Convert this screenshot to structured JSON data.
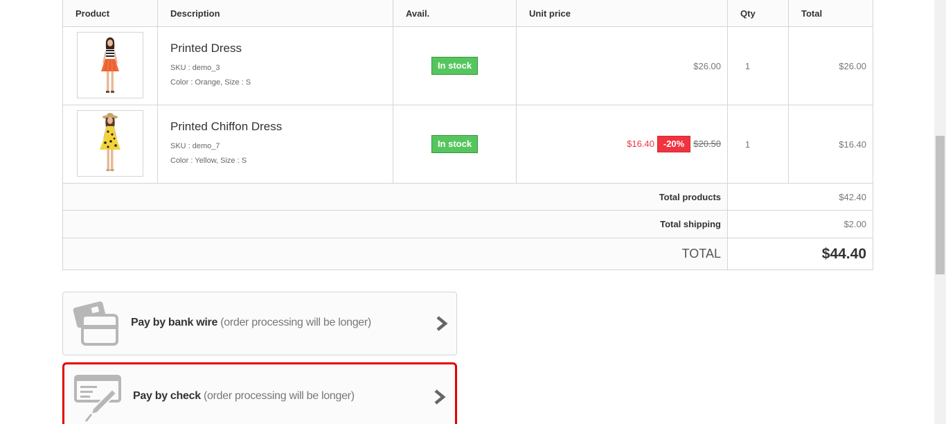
{
  "table": {
    "headers": [
      "Product",
      "Description",
      "Avail.",
      "Unit price",
      "Qty",
      "Total"
    ],
    "items": [
      {
        "name": "Printed Dress",
        "sku": "SKU : demo_3",
        "attributes": "Color : Orange, Size : S",
        "availability": "In stock",
        "unit_price": "$26.00",
        "qty": "1",
        "total": "$26.00"
      },
      {
        "name": "Printed Chiffon Dress",
        "sku": "SKU : demo_7",
        "attributes": "Color : Yellow, Size : S",
        "availability": "In stock",
        "special_price": "$16.40",
        "reduction": "-20%",
        "old_price": "$20.50",
        "qty": "1",
        "total": "$16.40"
      }
    ],
    "summary": {
      "total_products_label": "Total products",
      "total_products": "$42.40",
      "total_shipping_label": "Total shipping",
      "total_shipping": "$2.00",
      "total_label": "TOTAL",
      "total": "$44.40"
    }
  },
  "payment": {
    "bankwire": {
      "title": "Pay by bank wire",
      "note": "(order processing will be longer)",
      "icon": "credit-card-icon"
    },
    "cheque": {
      "title": "Pay by check",
      "note": "(order processing will be longer)",
      "icon": "cheque-pen-icon"
    }
  },
  "colors": {
    "stock_green": "#55c65e",
    "discount_red": "#f13340",
    "highlight_border": "#e40000"
  }
}
